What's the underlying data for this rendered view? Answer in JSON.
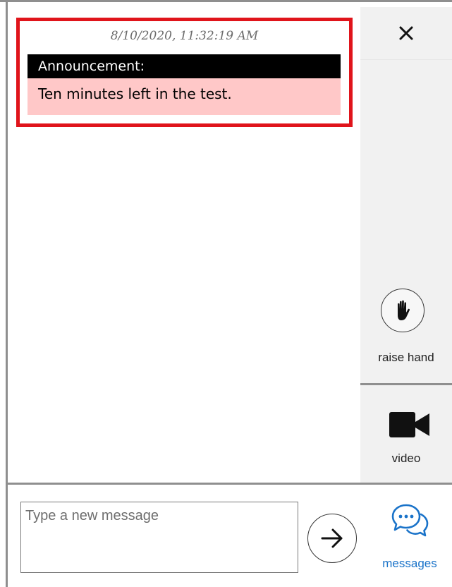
{
  "announcement": {
    "timestamp": "8/10/2020, 11:32:19 AM",
    "header": "Announcement:",
    "body": "Ten minutes left in the test.",
    "highlight_color": "#e0141b",
    "header_bg": "#000000",
    "body_bg": "#ffc8c8"
  },
  "sidebar": {
    "close_icon": "close-icon",
    "raise_hand": {
      "icon": "raised-hand-icon",
      "label": "raise hand"
    },
    "video": {
      "icon": "video-camera-icon",
      "label": "video"
    }
  },
  "composer": {
    "placeholder": "Type a new message",
    "value": "",
    "send_icon": "arrow-right-icon"
  },
  "messages_tab": {
    "icon": "chat-bubbles-icon",
    "label": "messages",
    "accent_color": "#1a73c9"
  }
}
